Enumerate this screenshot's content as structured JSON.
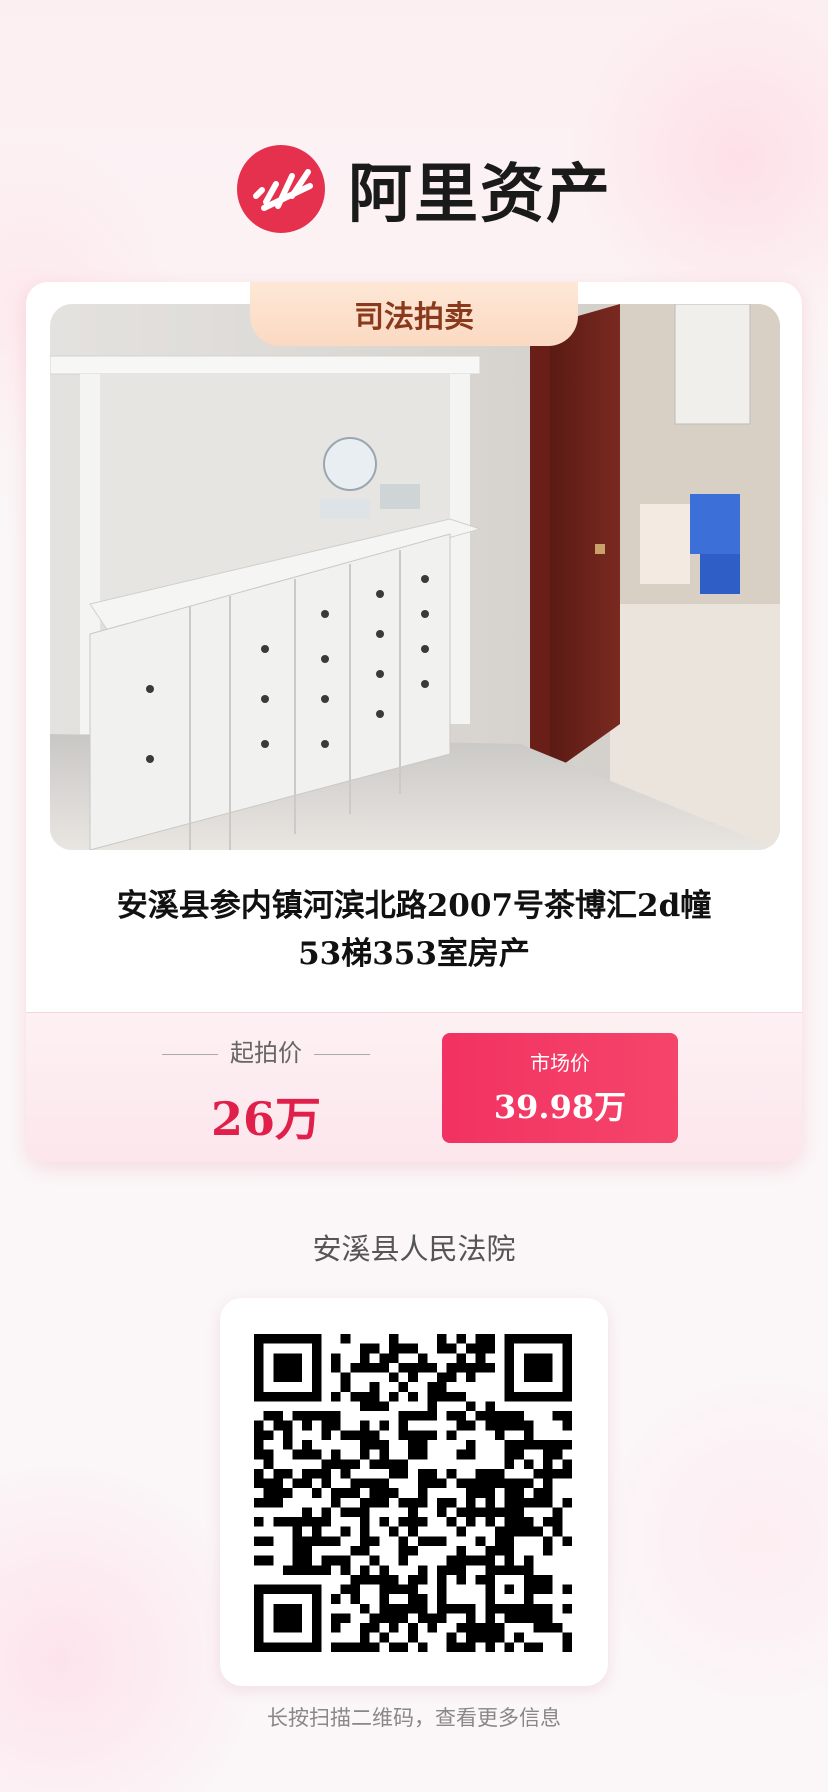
{
  "brand": {
    "name": "阿里资产",
    "logo_icon": "ali-asset-logo-icon",
    "color": "#e5314e"
  },
  "auction": {
    "tag": "司法拍卖",
    "title_line1": "安溪县参内镇河滨北路2007号茶博汇2d幢",
    "title_line2": "53梯353室房产"
  },
  "price": {
    "start_label": "起拍价",
    "start_value": "26万",
    "market_label": "市场价",
    "market_value": "39.98万"
  },
  "court": "安溪县人民法院",
  "qr": {
    "hint": "长按扫描二维码，查看更多信息"
  },
  "colors": {
    "accent": "#e0204a",
    "market_bg": "#f23262",
    "tag_bg": "#fbd9c2"
  }
}
